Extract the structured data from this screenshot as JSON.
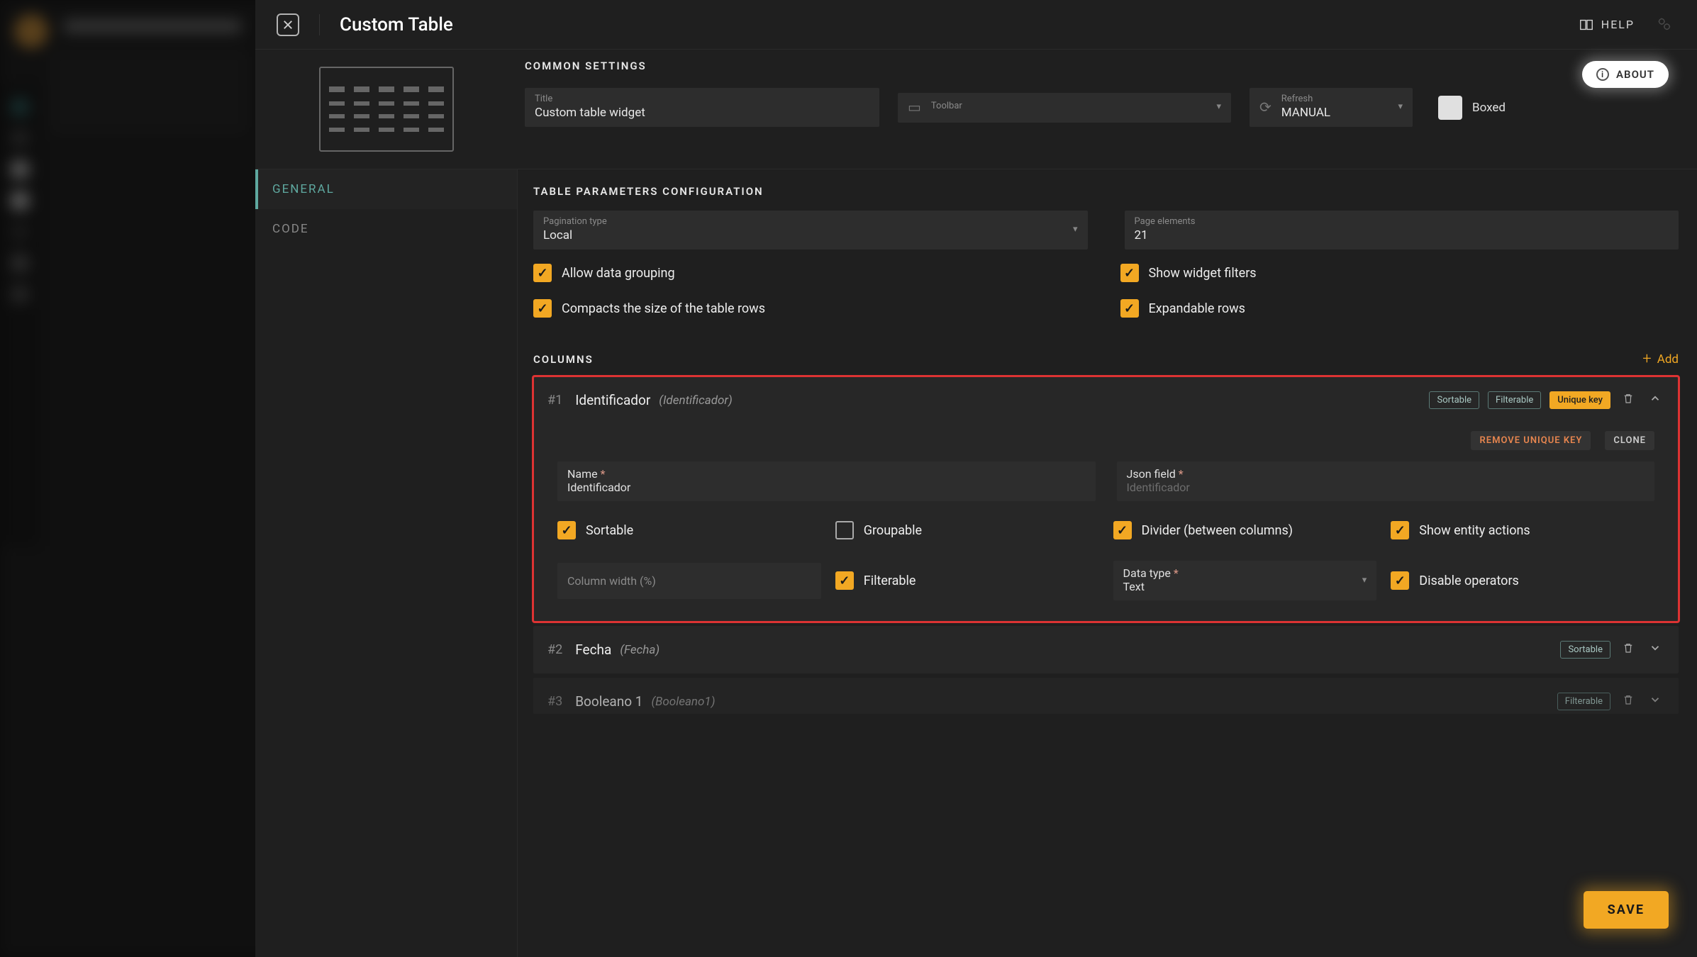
{
  "header": {
    "title": "Custom Table",
    "help": "HELP",
    "about": "ABOUT"
  },
  "common": {
    "section": "COMMON SETTINGS",
    "title_label": "Title",
    "title_value": "Custom table widget",
    "toolbar_label": "Toolbar",
    "toolbar_value": "",
    "refresh_label": "Refresh",
    "refresh_value": "MANUAL",
    "boxed_label": "Boxed"
  },
  "tabs": {
    "general": "GENERAL",
    "code": "CODE"
  },
  "params": {
    "section": "TABLE PARAMETERS CONFIGURATION",
    "pagination_label": "Pagination type",
    "pagination_value": "Local",
    "pageelem_label": "Page elements",
    "pageelem_value": "21",
    "chk_group": "Allow data grouping",
    "chk_filters": "Show widget filters",
    "chk_compact": "Compacts the size of the table rows",
    "chk_expand": "Expandable rows"
  },
  "columns": {
    "section": "COLUMNS",
    "add": "Add",
    "items": [
      {
        "idx": "#1",
        "name": "Identificador",
        "sub": "(Identificador)",
        "pills": {
          "sortable": "Sortable",
          "filterable": "Filterable",
          "unique": "Unique key"
        },
        "actions": {
          "remove": "REMOVE UNIQUE KEY",
          "clone": "CLONE"
        },
        "fields": {
          "name_label": "Name",
          "name_value": "Identificador",
          "json_label": "Json field",
          "json_value": "Identificador",
          "colwidth_label": "Column width (%)",
          "datatype_label": "Data type",
          "datatype_value": "Text"
        },
        "checks": {
          "sortable": "Sortable",
          "groupable": "Groupable",
          "divider": "Divider (between columns)",
          "entity": "Show entity actions",
          "filterable": "Filterable",
          "disable_ops": "Disable operators"
        }
      },
      {
        "idx": "#2",
        "name": "Fecha",
        "sub": "(Fecha)",
        "pill_sortable": "Sortable"
      },
      {
        "idx": "#3",
        "name": "Booleano 1",
        "sub": "(Booleano1)",
        "pill_filterable": "Filterable"
      }
    ]
  },
  "footer": {
    "save": "SAVE"
  }
}
